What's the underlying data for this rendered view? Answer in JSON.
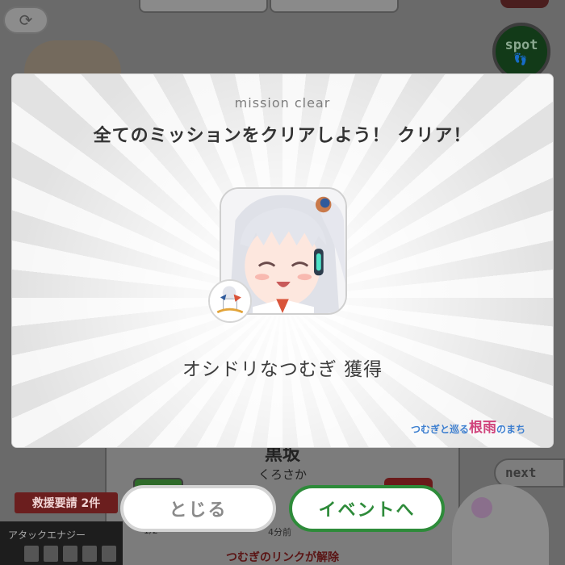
{
  "background": {
    "spot_label": "spot",
    "spot_feet": "👣",
    "refresh_icon": "⟳",
    "place_name": "黒坂",
    "place_kana": "くろさか",
    "time_ago": "4分前",
    "small_num": "1/2",
    "link_text": "つむぎのリンクが解除",
    "next_label": "next",
    "support_label": "救援要請 2件",
    "energy_label": "アタックエナジー"
  },
  "modal": {
    "label": "mission clear",
    "title": "全てのミッションをクリアしよう！ クリア！",
    "reward_text": "オシドリなつむぎ 獲得",
    "logo_a": "つむぎと巡る",
    "logo_b": "根雨",
    "logo_c": "のまち"
  },
  "buttons": {
    "close": "とじる",
    "event": "イベントへ"
  },
  "colors": {
    "event_green": "#2e8b3a",
    "close_gray": "#8a8a8a",
    "support_red": "#6b1e1e"
  }
}
